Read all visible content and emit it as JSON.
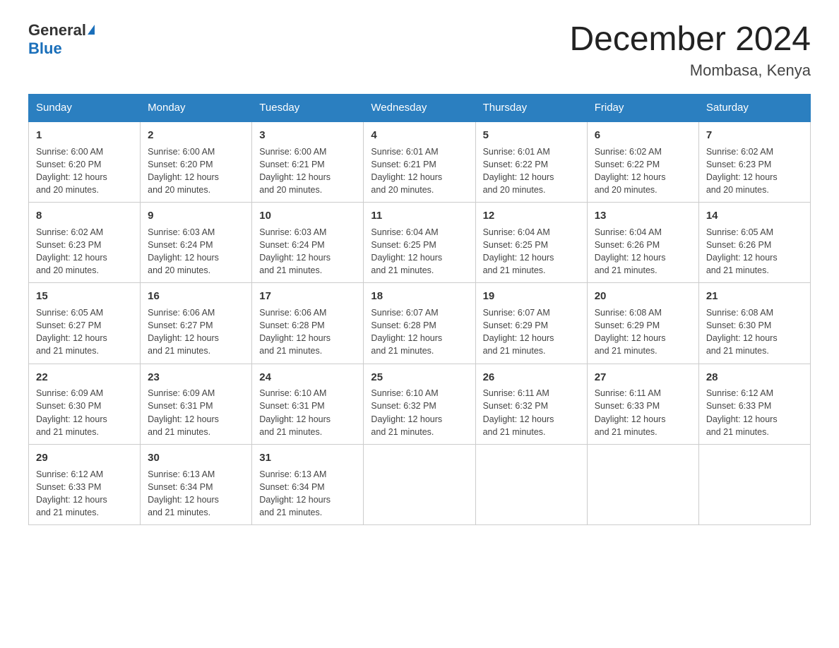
{
  "logo": {
    "general": "General",
    "blue": "Blue"
  },
  "title": "December 2024",
  "subtitle": "Mombasa, Kenya",
  "headers": [
    "Sunday",
    "Monday",
    "Tuesday",
    "Wednesday",
    "Thursday",
    "Friday",
    "Saturday"
  ],
  "weeks": [
    [
      {
        "day": "1",
        "sunrise": "6:00 AM",
        "sunset": "6:20 PM",
        "daylight": "12 hours and 20 minutes."
      },
      {
        "day": "2",
        "sunrise": "6:00 AM",
        "sunset": "6:20 PM",
        "daylight": "12 hours and 20 minutes."
      },
      {
        "day": "3",
        "sunrise": "6:00 AM",
        "sunset": "6:21 PM",
        "daylight": "12 hours and 20 minutes."
      },
      {
        "day": "4",
        "sunrise": "6:01 AM",
        "sunset": "6:21 PM",
        "daylight": "12 hours and 20 minutes."
      },
      {
        "day": "5",
        "sunrise": "6:01 AM",
        "sunset": "6:22 PM",
        "daylight": "12 hours and 20 minutes."
      },
      {
        "day": "6",
        "sunrise": "6:02 AM",
        "sunset": "6:22 PM",
        "daylight": "12 hours and 20 minutes."
      },
      {
        "day": "7",
        "sunrise": "6:02 AM",
        "sunset": "6:23 PM",
        "daylight": "12 hours and 20 minutes."
      }
    ],
    [
      {
        "day": "8",
        "sunrise": "6:02 AM",
        "sunset": "6:23 PM",
        "daylight": "12 hours and 20 minutes."
      },
      {
        "day": "9",
        "sunrise": "6:03 AM",
        "sunset": "6:24 PM",
        "daylight": "12 hours and 20 minutes."
      },
      {
        "day": "10",
        "sunrise": "6:03 AM",
        "sunset": "6:24 PM",
        "daylight": "12 hours and 21 minutes."
      },
      {
        "day": "11",
        "sunrise": "6:04 AM",
        "sunset": "6:25 PM",
        "daylight": "12 hours and 21 minutes."
      },
      {
        "day": "12",
        "sunrise": "6:04 AM",
        "sunset": "6:25 PM",
        "daylight": "12 hours and 21 minutes."
      },
      {
        "day": "13",
        "sunrise": "6:04 AM",
        "sunset": "6:26 PM",
        "daylight": "12 hours and 21 minutes."
      },
      {
        "day": "14",
        "sunrise": "6:05 AM",
        "sunset": "6:26 PM",
        "daylight": "12 hours and 21 minutes."
      }
    ],
    [
      {
        "day": "15",
        "sunrise": "6:05 AM",
        "sunset": "6:27 PM",
        "daylight": "12 hours and 21 minutes."
      },
      {
        "day": "16",
        "sunrise": "6:06 AM",
        "sunset": "6:27 PM",
        "daylight": "12 hours and 21 minutes."
      },
      {
        "day": "17",
        "sunrise": "6:06 AM",
        "sunset": "6:28 PM",
        "daylight": "12 hours and 21 minutes."
      },
      {
        "day": "18",
        "sunrise": "6:07 AM",
        "sunset": "6:28 PM",
        "daylight": "12 hours and 21 minutes."
      },
      {
        "day": "19",
        "sunrise": "6:07 AM",
        "sunset": "6:29 PM",
        "daylight": "12 hours and 21 minutes."
      },
      {
        "day": "20",
        "sunrise": "6:08 AM",
        "sunset": "6:29 PM",
        "daylight": "12 hours and 21 minutes."
      },
      {
        "day": "21",
        "sunrise": "6:08 AM",
        "sunset": "6:30 PM",
        "daylight": "12 hours and 21 minutes."
      }
    ],
    [
      {
        "day": "22",
        "sunrise": "6:09 AM",
        "sunset": "6:30 PM",
        "daylight": "12 hours and 21 minutes."
      },
      {
        "day": "23",
        "sunrise": "6:09 AM",
        "sunset": "6:31 PM",
        "daylight": "12 hours and 21 minutes."
      },
      {
        "day": "24",
        "sunrise": "6:10 AM",
        "sunset": "6:31 PM",
        "daylight": "12 hours and 21 minutes."
      },
      {
        "day": "25",
        "sunrise": "6:10 AM",
        "sunset": "6:32 PM",
        "daylight": "12 hours and 21 minutes."
      },
      {
        "day": "26",
        "sunrise": "6:11 AM",
        "sunset": "6:32 PM",
        "daylight": "12 hours and 21 minutes."
      },
      {
        "day": "27",
        "sunrise": "6:11 AM",
        "sunset": "6:33 PM",
        "daylight": "12 hours and 21 minutes."
      },
      {
        "day": "28",
        "sunrise": "6:12 AM",
        "sunset": "6:33 PM",
        "daylight": "12 hours and 21 minutes."
      }
    ],
    [
      {
        "day": "29",
        "sunrise": "6:12 AM",
        "sunset": "6:33 PM",
        "daylight": "12 hours and 21 minutes."
      },
      {
        "day": "30",
        "sunrise": "6:13 AM",
        "sunset": "6:34 PM",
        "daylight": "12 hours and 21 minutes."
      },
      {
        "day": "31",
        "sunrise": "6:13 AM",
        "sunset": "6:34 PM",
        "daylight": "12 hours and 21 minutes."
      },
      null,
      null,
      null,
      null
    ]
  ],
  "labels": {
    "sunrise": "Sunrise:",
    "sunset": "Sunset:",
    "daylight": "Daylight:"
  }
}
